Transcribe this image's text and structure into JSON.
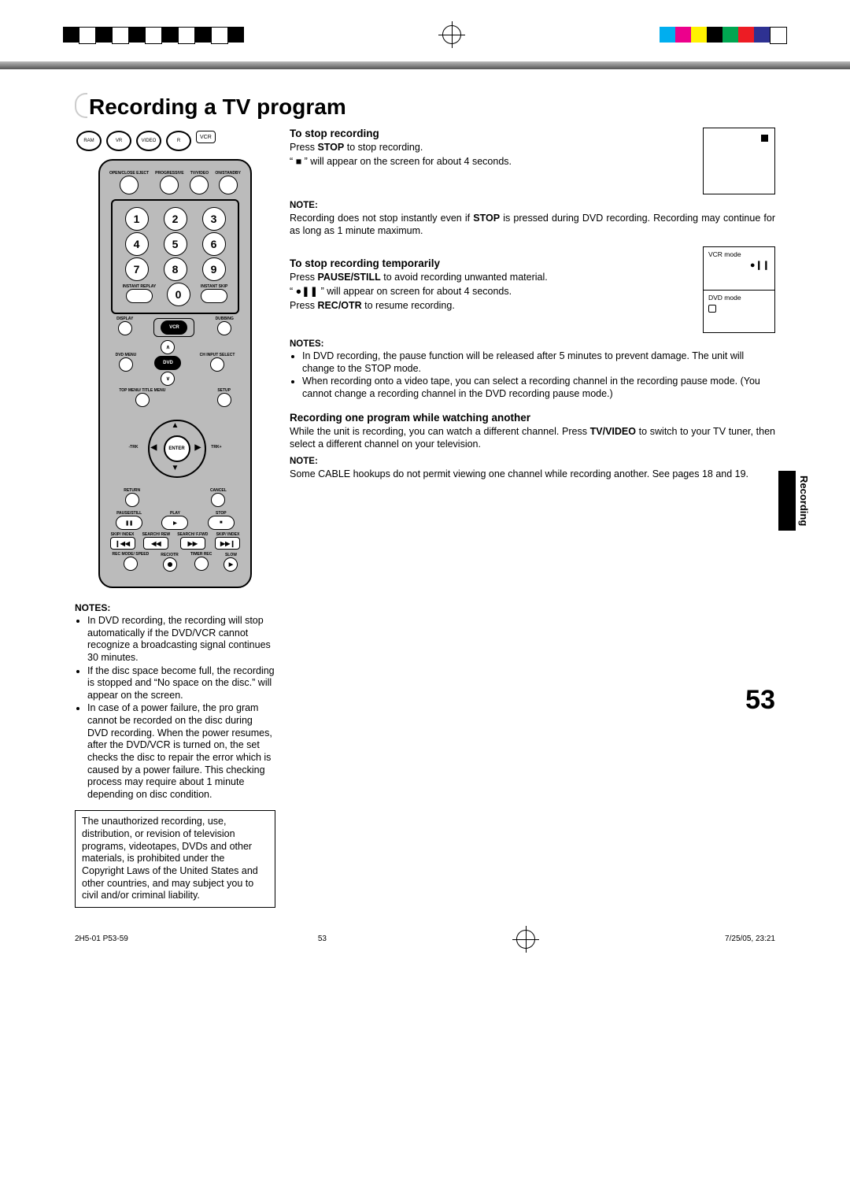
{
  "print_marks": {
    "bw_bars": [
      "#000",
      "#fff",
      "#000",
      "#fff",
      "#000",
      "#fff",
      "#000",
      "#fff",
      "#000",
      "#fff",
      "#000"
    ],
    "color_bars": [
      "#00aeef",
      "#ec008c",
      "#fff200",
      "#000000",
      "#00a651",
      "#ed1c24",
      "#2e3192",
      "#ffffff"
    ]
  },
  "page_title": "Recording a TV program",
  "disc_labels": [
    "RAM",
    "VR",
    "VIDEO",
    "R",
    "VCR"
  ],
  "remote": {
    "row1": [
      "OPEN/CLOSE EJECT",
      "PROGRESSIVE",
      "TV/VIDEO",
      "ON/STANDBY"
    ],
    "numbers": [
      "1",
      "2",
      "3",
      "4",
      "5",
      "6",
      "7",
      "8",
      "9",
      "0"
    ],
    "instant_left": "INSTANT REPLAY",
    "instant_right": "INSTANT SKIP",
    "display": "DISPLAY",
    "dubbing": "DUBBING",
    "vcr": "VCR",
    "dvd": "DVD",
    "dvd_menu": "DVD MENU",
    "ch": "CH",
    "input_select": "INPUT SELECT",
    "top_menu": "TOP MENU/ TITLE MENU",
    "setup": "SETUP",
    "enter": "ENTER",
    "trk_minus": "-TRK",
    "trk_plus": "TRK+",
    "return": "RETURN",
    "cancel": "CANCEL",
    "pause": "PAUSE/STILL",
    "play": "PLAY",
    "stop": "STOP",
    "transport": [
      "SKIP/ INDEX",
      "SEARCH/ REW",
      "SEARCH/ F.FWD",
      "SKIP/ INDEX"
    ],
    "rec_row": [
      "REC MODE/ SPEED",
      "REC/OTR",
      "TIMER REC",
      "SLOW"
    ]
  },
  "left_notes_heading": "NOTES:",
  "left_notes": [
    "In DVD recording, the recording will stop automatically if the DVD/VCR cannot recognize a broadcasting signal continues 30 minutes.",
    "If the disc space become full, the recording is stopped and “No space on the disc.” will appear on the screen.",
    "In case of a power failure, the pro gram cannot be recorded on the disc during DVD recording. When the power resumes, after the DVD/VCR is turned on, the set checks the disc to repair the error which is caused by a power failure. This checking process may require about 1 minute depending on disc condition."
  ],
  "warning_text": "The unauthorized recording, use, distribution, or revision of television programs, videotapes, DVDs and other materials, is prohibited under the Copyright Laws of the United States and other countries, and may subject you to civil and/or criminal liability.",
  "sections": {
    "s1": {
      "heading": "To stop recording",
      "p1_a": "Press ",
      "p1_b": "STOP",
      "p1_c": " to stop recording.",
      "p2": "“ ■ ” will appear on the screen for about 4 seconds.",
      "note_label": "NOTE:",
      "note_a": "Recording does not stop instantly even if ",
      "note_b": "STOP",
      "note_c": " is pressed during DVD recording. Recording may continue for as long as 1 minute maximum."
    },
    "s2": {
      "heading": "To stop recording temporarily",
      "p1_a": "Press ",
      "p1_b": "PAUSE/STILL",
      "p1_c": " to avoid recording unwanted material.",
      "p2": "“ ●❚❚ ” will appear on screen for about 4 seconds.",
      "p3_a": "Press ",
      "p3_b": "REC/OTR",
      "p3_c": " to resume recording.",
      "box_vcr": "VCR mode",
      "box_dvd": "DVD mode",
      "notes_label": "NOTES:",
      "notes": [
        "In DVD recording, the pause function will be released after 5 minutes to prevent damage. The unit will change to the STOP mode.",
        "When recording onto a video tape, you can select a recording channel in the recording pause mode. (You cannot change a recording channel in the DVD recording pause mode.)"
      ]
    },
    "s3": {
      "heading": "Recording one program while watching another",
      "p1_a": "While the unit is recording, you can watch a different channel. Press ",
      "p1_b": "TV/VIDEO",
      "p1_c": " to switch to your TV tuner, then select a different channel on your television.",
      "note_label": "NOTE:",
      "note": "Some CABLE hookups do not permit viewing one channel while recording another. See pages 18 and 19."
    }
  },
  "side_tab": "Recording",
  "page_number": "53",
  "footer": {
    "left": "2H5-01 P53-59",
    "center": "53",
    "right": "7/25/05, 23:21"
  }
}
